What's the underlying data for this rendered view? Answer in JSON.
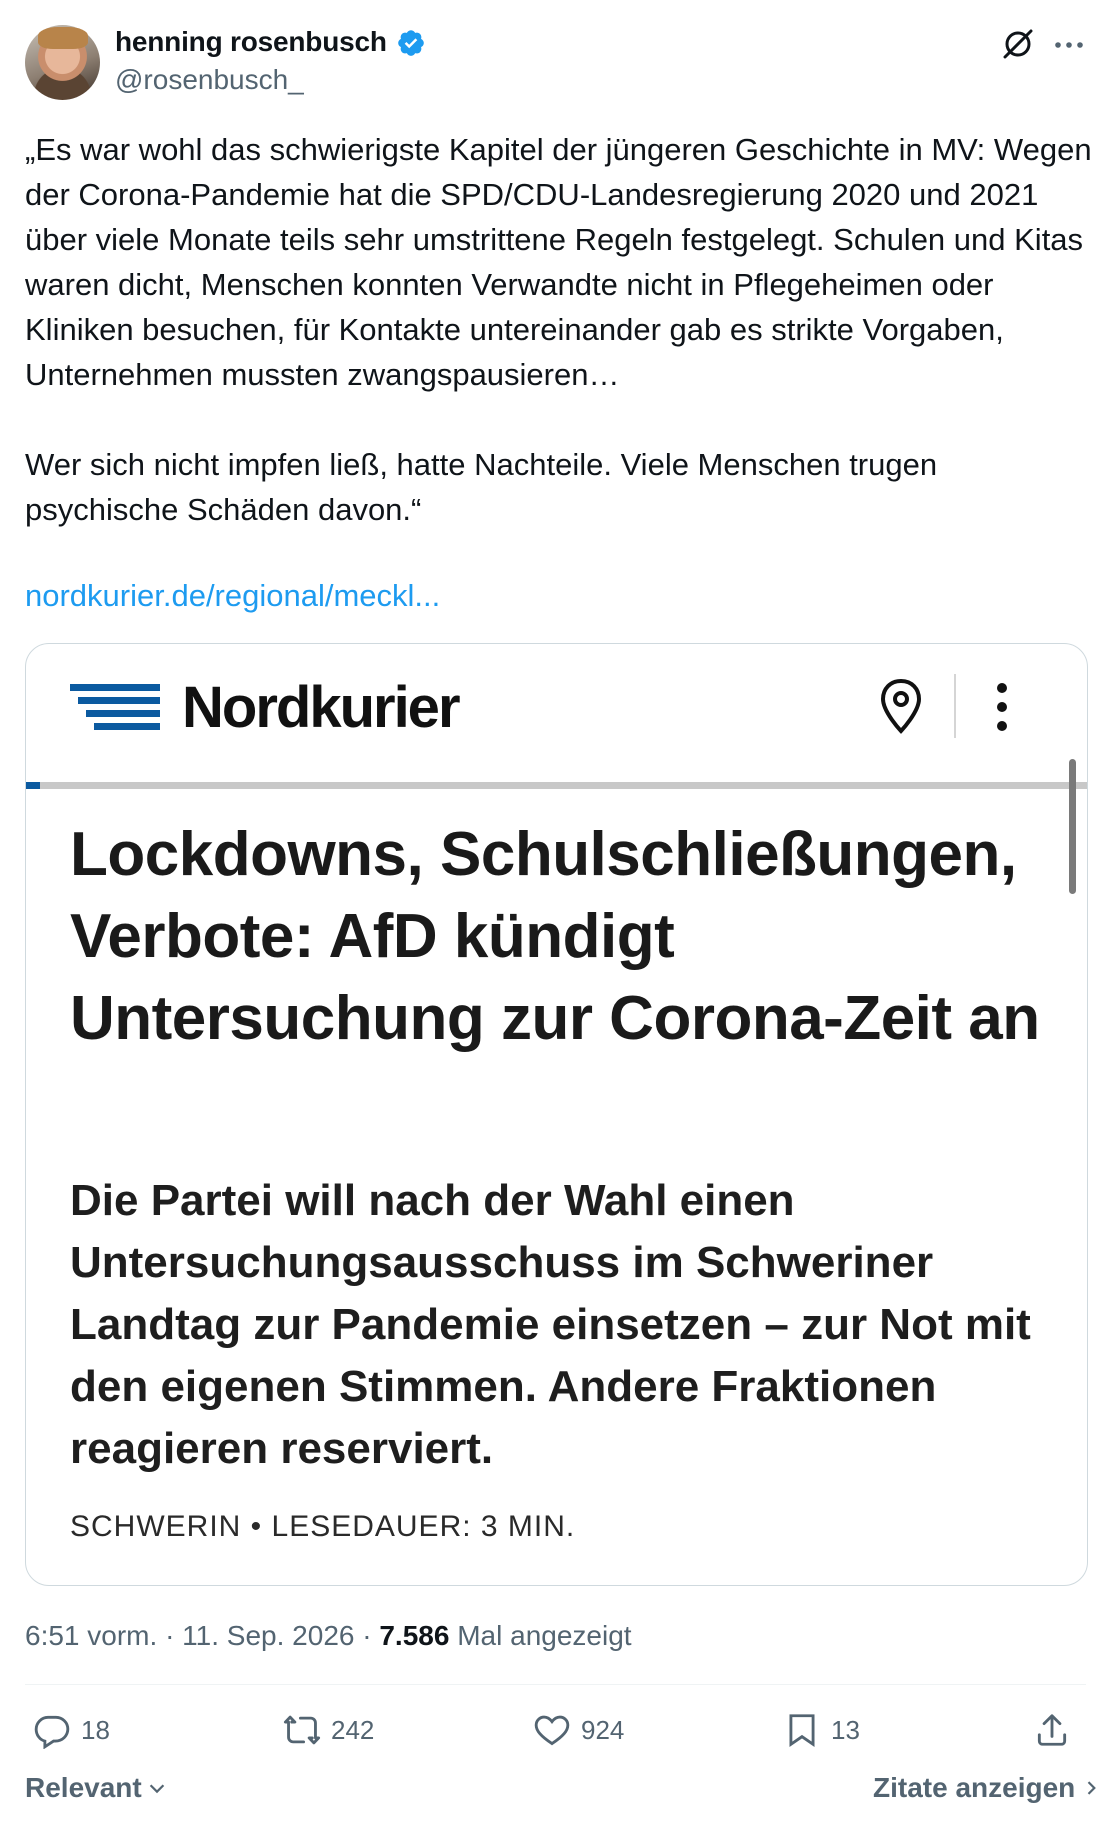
{
  "author": {
    "name": "henning rosenbusch",
    "handle": "@rosenbusch_",
    "verified": true,
    "avatar_icon": "avatar-photo"
  },
  "tweet": {
    "text": "„Es war wohl das schwierigste Kapitel der jüngeren Geschichte in MV: Wegen der Corona-Pandemie hat die SPD/CDU-Landesregierung 2020 und 2021 über viele Monate teils sehr umstrittene Regeln festgelegt. Schulen und Kitas waren dicht, Menschen konnten Verwandte nicht in Pflegeheimen oder Kliniken besuchen, für Kontakte untereinander gab es strikte Vorgaben, Unternehmen mussten zwangspausieren…\n\nWer sich nicht impfen ließ, hatte Nachteile. Viele Menschen trugen psychische Schäden davon.“",
    "link": "nordkurier.de/regional/meckl..."
  },
  "card": {
    "logo": "Nordkurier",
    "headline": "Lockdowns, Schulschließungen, Verbote: AfD kündigt Untersuchung zur Corona-Zeit an",
    "subheadline": "Die Partei will nach der Wahl einen Untersuchungsausschuss im Schweriner Landtag zur Pandemie einsetzen – zur Not mit den eigenen Stimmen. Andere Fraktionen reagieren reserviert.",
    "dateline": "SCHWERIN • LESEDAUER: 3 MIN."
  },
  "meta": {
    "time": "6:51 vorm.",
    "date": "11. Sep. 2026",
    "views": "7.586",
    "views_label": "Mal angezeigt"
  },
  "actions": {
    "replies": "18",
    "reposts": "242",
    "likes": "924",
    "bookmarks": "13"
  },
  "footer": {
    "sort_label": "Relevant",
    "quotes_label": "Zitate anzeigen"
  },
  "colors": {
    "link": "#1d9bf0",
    "muted": "#536471",
    "verified": "#1d9bf0",
    "nordkurier_blue": "#0b5aa0"
  }
}
